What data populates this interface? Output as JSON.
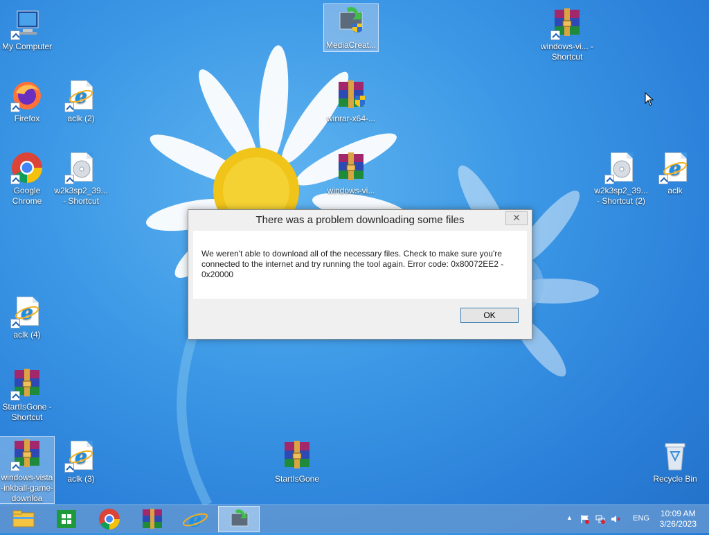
{
  "desktop": {
    "icons": [
      {
        "label": "My Computer"
      },
      {
        "label": "Firefox"
      },
      {
        "label": "aclk (2)"
      },
      {
        "label": "Google Chrome"
      },
      {
        "label": "w2k3sp2_39... - Shortcut"
      },
      {
        "label": "aclk (4)"
      },
      {
        "label": "StartIsGone - Shortcut"
      },
      {
        "label": "windows-vista-inkball-game-downloa"
      },
      {
        "label": "aclk (3)"
      },
      {
        "label": "MediaCreat..."
      },
      {
        "label": "winrar-x64-..."
      },
      {
        "label": "windows-vi..."
      },
      {
        "label": "StartIsGone"
      },
      {
        "label": "windows-vi... - Shortcut"
      },
      {
        "label": "w2k3sp2_39... - Shortcut (2)"
      },
      {
        "label": "aclk"
      },
      {
        "label": "Recycle Bin"
      }
    ]
  },
  "dialog": {
    "title": "There was a problem downloading some files",
    "close_glyph": "✕",
    "message": "We weren't able to download all of the necessary files. Check to make sure you're connected to the internet and try running the tool again. Error code: 0x80072EE2 - 0x20000",
    "ok_label": "OK"
  },
  "taskbar": {
    "language": "ENG",
    "time": "10:09 AM",
    "date": "3/26/2023",
    "tray_chevron": "▲"
  },
  "colors": {
    "desktop_bg": "#3c98e6",
    "taskbar_bg": "#6096d2",
    "dialog_bg": "#f0f0f0",
    "ok_border": "#3c7fb1"
  }
}
